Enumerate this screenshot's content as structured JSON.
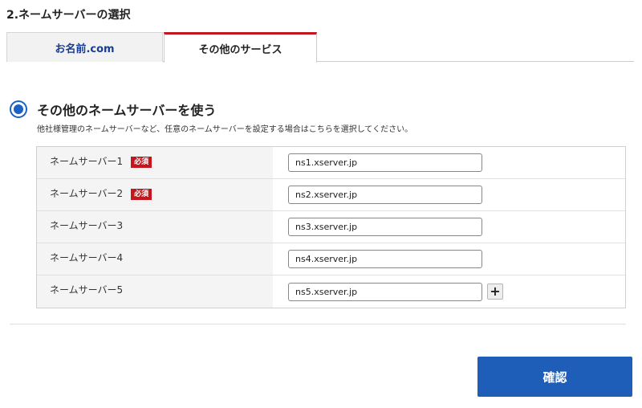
{
  "section": {
    "title": "2.ネームサーバーの選択"
  },
  "tabs": [
    {
      "label": "お名前.com",
      "active": false
    },
    {
      "label": "その他のサービス",
      "active": true
    }
  ],
  "option": {
    "title": "その他のネームサーバーを使う",
    "description": "他社様管理のネームサーバーなど、任意のネームサーバーを設定する場合はこちらを選択してください。",
    "selected": true
  },
  "nameservers": [
    {
      "label": "ネームサーバー1",
      "required_label": "必須",
      "value": "ns1.xserver.jp"
    },
    {
      "label": "ネームサーバー2",
      "required_label": "必須",
      "value": "ns2.xserver.jp"
    },
    {
      "label": "ネームサーバー3",
      "value": "ns3.xserver.jp"
    },
    {
      "label": "ネームサーバー4",
      "value": "ns4.xserver.jp"
    },
    {
      "label": "ネームサーバー5",
      "value": "ns5.xserver.jp"
    }
  ],
  "add_button": {
    "icon": "plus-icon",
    "label": "+"
  },
  "confirm": {
    "label": "確認"
  },
  "colors": {
    "accent_blue": "#1e5eb8",
    "required_red": "#c4161c",
    "tab_inactive_text": "#1a3d8f"
  }
}
